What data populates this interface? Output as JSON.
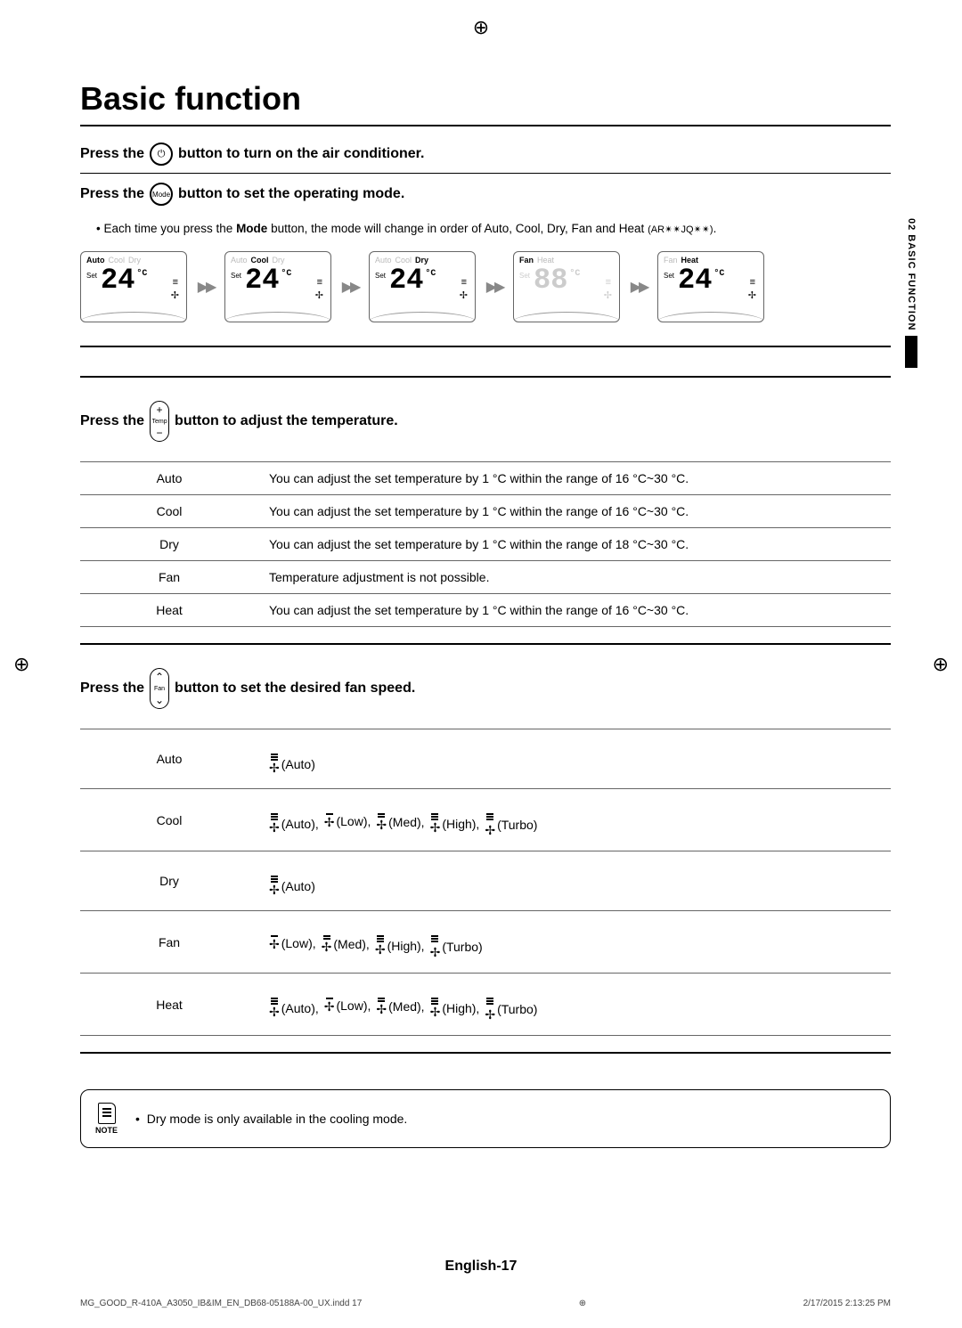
{
  "title": "Basic function",
  "side_tab": "02  BASIC FUNCTION",
  "power_line": {
    "pre": "Press the",
    "post": "button to turn on the air conditioner."
  },
  "mode_line": {
    "pre": "Press the",
    "btn": "Mode",
    "post": "button to set the operating mode."
  },
  "mode_bullet_pre": "Each time you press the ",
  "mode_bullet_bold": "Mode",
  "mode_bullet_post": " button, the mode will change in order of Auto, Cool, Dry, Fan and Heat ",
  "mode_bullet_model": "(AR✴✴JQ✴✴)",
  "mode_bullet_end": ".",
  "screens": [
    {
      "labels": [
        "Auto",
        "Cool",
        "Dry"
      ],
      "active": "Auto",
      "temp": "24",
      "unit": "°C",
      "set": "Set",
      "blank": false
    },
    {
      "labels": [
        "Auto",
        "Cool",
        "Dry"
      ],
      "active": "Cool",
      "temp": "24",
      "unit": "°C",
      "set": "Set",
      "blank": false
    },
    {
      "labels": [
        "Auto",
        "Cool",
        "Dry"
      ],
      "active": "Dry",
      "temp": "24",
      "unit": "°C",
      "set": "Set",
      "blank": false
    },
    {
      "labels": [
        "Fan",
        "Heat"
      ],
      "active": "Fan",
      "temp": "88",
      "unit": "°C",
      "set": "Set",
      "blank": true
    },
    {
      "labels": [
        "Fan",
        "Heat"
      ],
      "active": "Heat",
      "temp": "24",
      "unit": "°C",
      "set": "Set",
      "blank": false
    }
  ],
  "temp_line": {
    "pre": "Press the",
    "btn_top": "+",
    "btn_mid": "Temp",
    "btn_bot": "−",
    "post": "button to adjust the temperature."
  },
  "temp_table": [
    {
      "mode": "Auto",
      "desc": "You can adjust the set temperature by 1 °C within the range of 16 °C~30 °C."
    },
    {
      "mode": "Cool",
      "desc": "You can adjust the set temperature by 1 °C within the range of 16 °C~30 °C."
    },
    {
      "mode": "Dry",
      "desc": "You can adjust the set temperature by 1 °C within the range of 18 °C~30 °C."
    },
    {
      "mode": "Fan",
      "desc": "Temperature adjustment is not possible."
    },
    {
      "mode": "Heat",
      "desc": "You can adjust the set temperature by 1 °C within the range of 16 °C~30 °C."
    }
  ],
  "fan_line": {
    "pre": "Press the",
    "btn_top": "⌃",
    "btn_mid": "Fan",
    "btn_bot": "⌄",
    "post": "button to set the desired fan speed."
  },
  "fan_labels": {
    "auto": "(Auto)",
    "low": "(Low)",
    "med": "(Med)",
    "high": "(High)",
    "turbo": "(Turbo)"
  },
  "fan_table": [
    {
      "mode": "Auto",
      "speeds": [
        "auto"
      ]
    },
    {
      "mode": "Cool",
      "speeds": [
        "auto",
        "low",
        "med",
        "high",
        "turbo"
      ]
    },
    {
      "mode": "Dry",
      "speeds": [
        "auto"
      ]
    },
    {
      "mode": "Fan",
      "speeds": [
        "low",
        "med",
        "high",
        "turbo"
      ]
    },
    {
      "mode": "Heat",
      "speeds": [
        "auto",
        "low",
        "med",
        "high",
        "turbo"
      ]
    }
  ],
  "note_label": "NOTE",
  "note_text": "Dry mode is only available in the cooling mode.",
  "page_label": "English-17",
  "print_file": "MG_GOOD_R-410A_A3050_IB&IM_EN_DB68-05188A-00_UX.indd   17",
  "print_time": "2/17/2015   2:13:25 PM"
}
